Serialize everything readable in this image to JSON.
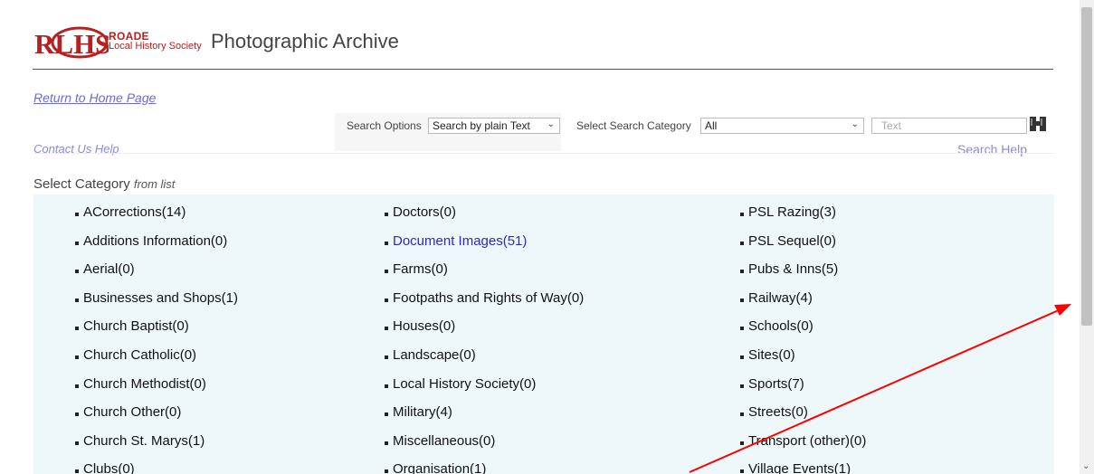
{
  "header": {
    "logo_line1": "ROADE",
    "logo_line2": "Local History Society",
    "title": "Photographic Archive"
  },
  "links": {
    "home": "Return to Home Page",
    "contact": "Contact Us Help",
    "search_help": "Search Help"
  },
  "search": {
    "options_label": "Search Options",
    "options_value": "Search by plain Text",
    "category_label": "Select Search Category",
    "category_value": "All",
    "text_placeholder": "Text"
  },
  "categories": {
    "heading": "Select Category",
    "heading_hint": "from list",
    "col1": [
      "ACorrections(14)",
      "Additions Information(0)",
      "Aerial(0)",
      "Businesses and Shops(1)",
      "Church Baptist(0)",
      "Church Catholic(0)",
      "Church Methodist(0)",
      "Church Other(0)",
      "Church St. Marys(1)",
      "Clubs(0)"
    ],
    "col2": [
      "Doctors(0)",
      "Document Images(51)",
      "Farms(0)",
      "Footpaths and Rights of Way(0)",
      "Houses(0)",
      "Landscape(0)",
      "Local History Society(0)",
      "Military(4)",
      "Miscellaneous(0)",
      "Organisation(1)"
    ],
    "col3": [
      "PSL Razing(3)",
      "PSL Sequel(0)",
      "Pubs & Inns(5)",
      "Railway(4)",
      "Schools(0)",
      "Sites(0)",
      "Sports(7)",
      "Streets(0)",
      "Transport (other)(0)",
      "Village Events(1)"
    ]
  },
  "colors": {
    "brand": "#b52020",
    "link": "#2a2abf",
    "category_bg": "#eef8fa",
    "annotation_arrow": "#ff0000"
  }
}
